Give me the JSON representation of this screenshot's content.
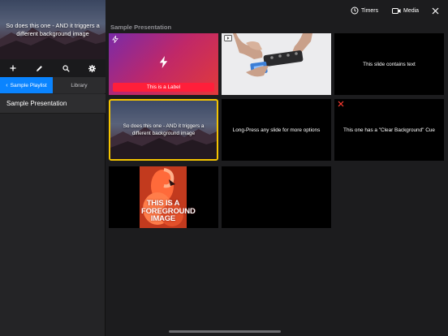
{
  "sidebar": {
    "preview_text": "So does this one - AND it triggers a different background image",
    "toolbar": {
      "icons": [
        "plus-icon",
        "pencil-icon",
        "search-icon",
        "gear-icon"
      ]
    },
    "segments": {
      "playlist_label": "Sample Playlist",
      "library_label": "Library",
      "active": "playlist"
    },
    "playlist_items": [
      {
        "label": "Sample Presentation"
      }
    ]
  },
  "topbar": {
    "timers_label": "Timers",
    "media_label": "Media",
    "close_icon": "close-icon"
  },
  "main": {
    "section_title": "Sample Presentation",
    "slides": [
      {
        "type": "gradient",
        "label": "This is a Label",
        "badge_icon": "bolt-icon",
        "icon": "bolt-icon"
      },
      {
        "type": "video",
        "badge_icon": "video-icon"
      },
      {
        "type": "text",
        "text": "This slide contains text"
      },
      {
        "type": "image-text",
        "text": "So does this one - AND it triggers a different background image",
        "selected": true
      },
      {
        "type": "text",
        "text": "Long-Press any slide for more options"
      },
      {
        "type": "text",
        "text": "This one has a \"Clear Background\" Cue",
        "badge_icon": "close-x-icon"
      },
      {
        "type": "image",
        "overlay_text": "THIS IS A FOREGROUND IMAGE"
      },
      {
        "type": "blank"
      }
    ]
  },
  "colors": {
    "accent_blue": "#0a84ff",
    "selected_border": "#f5c400",
    "label_red": "#ff1f3a"
  }
}
